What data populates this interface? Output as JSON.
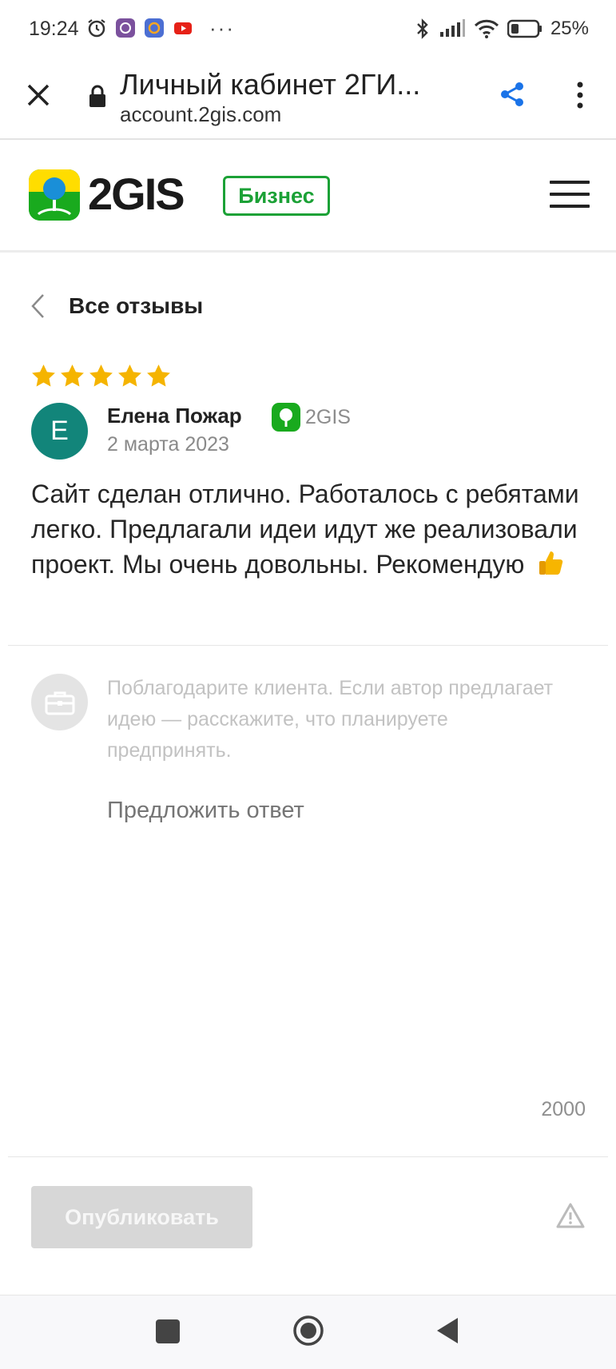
{
  "status_bar": {
    "time": "19:24",
    "dots": "···",
    "battery": "25%"
  },
  "browser": {
    "title": "Личный кабинет 2ГИ...",
    "url": "account.2gis.com"
  },
  "site": {
    "logo_text": "2GIS",
    "badge": "Бизнес"
  },
  "nav": {
    "back_label": "Все отзывы"
  },
  "review": {
    "rating": 5,
    "avatar_letter": "E",
    "author": "Елена Пожар",
    "source": "2GIS",
    "date": "2 марта 2023",
    "text": "Сайт сделан отлично. Работалось с ребятами легко. Предлагали идеи идут же реализовали проект. Мы очень довольны. Рекомендую"
  },
  "reply": {
    "hint": "Поблагодарите клиента. Если автор предлагает идею — расскажите, что планируете предпринять.",
    "placeholder": "Предложить ответ",
    "counter": "2000",
    "publish_label": "Опубликовать"
  },
  "colors": {
    "brand_green": "#1ba136",
    "star": "#f5b400",
    "avatar": "#12857a",
    "share_blue": "#1a73e8"
  },
  "icons": [
    "close-icon",
    "lock-icon",
    "share-icon",
    "more-icon",
    "menu-icon",
    "chevron-left-icon",
    "star-icon",
    "2gis-source-icon",
    "thumbs-up-icon",
    "briefcase-icon",
    "warning-icon"
  ]
}
